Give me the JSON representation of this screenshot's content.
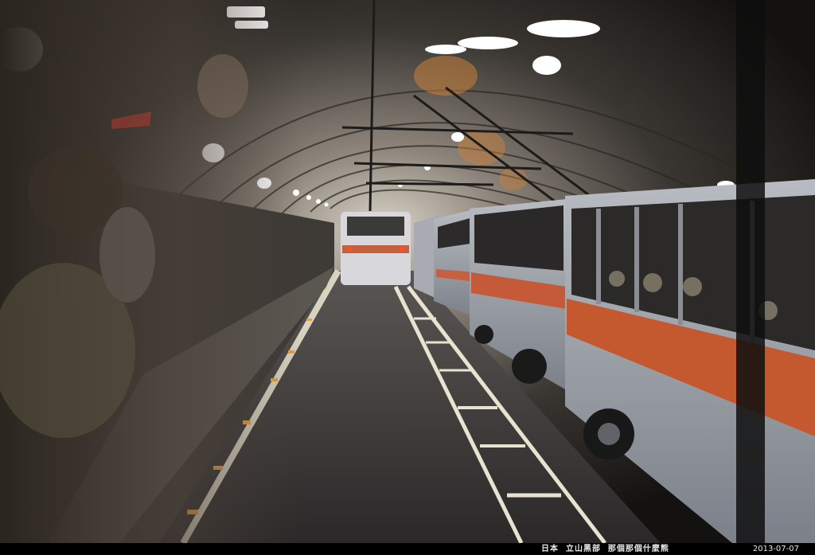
{
  "photo": {
    "subject": "trolleybuses"
  },
  "caption": {
    "text": "日本  立山黑部  那個那個什麼熊",
    "date": "2013-07-07"
  }
}
